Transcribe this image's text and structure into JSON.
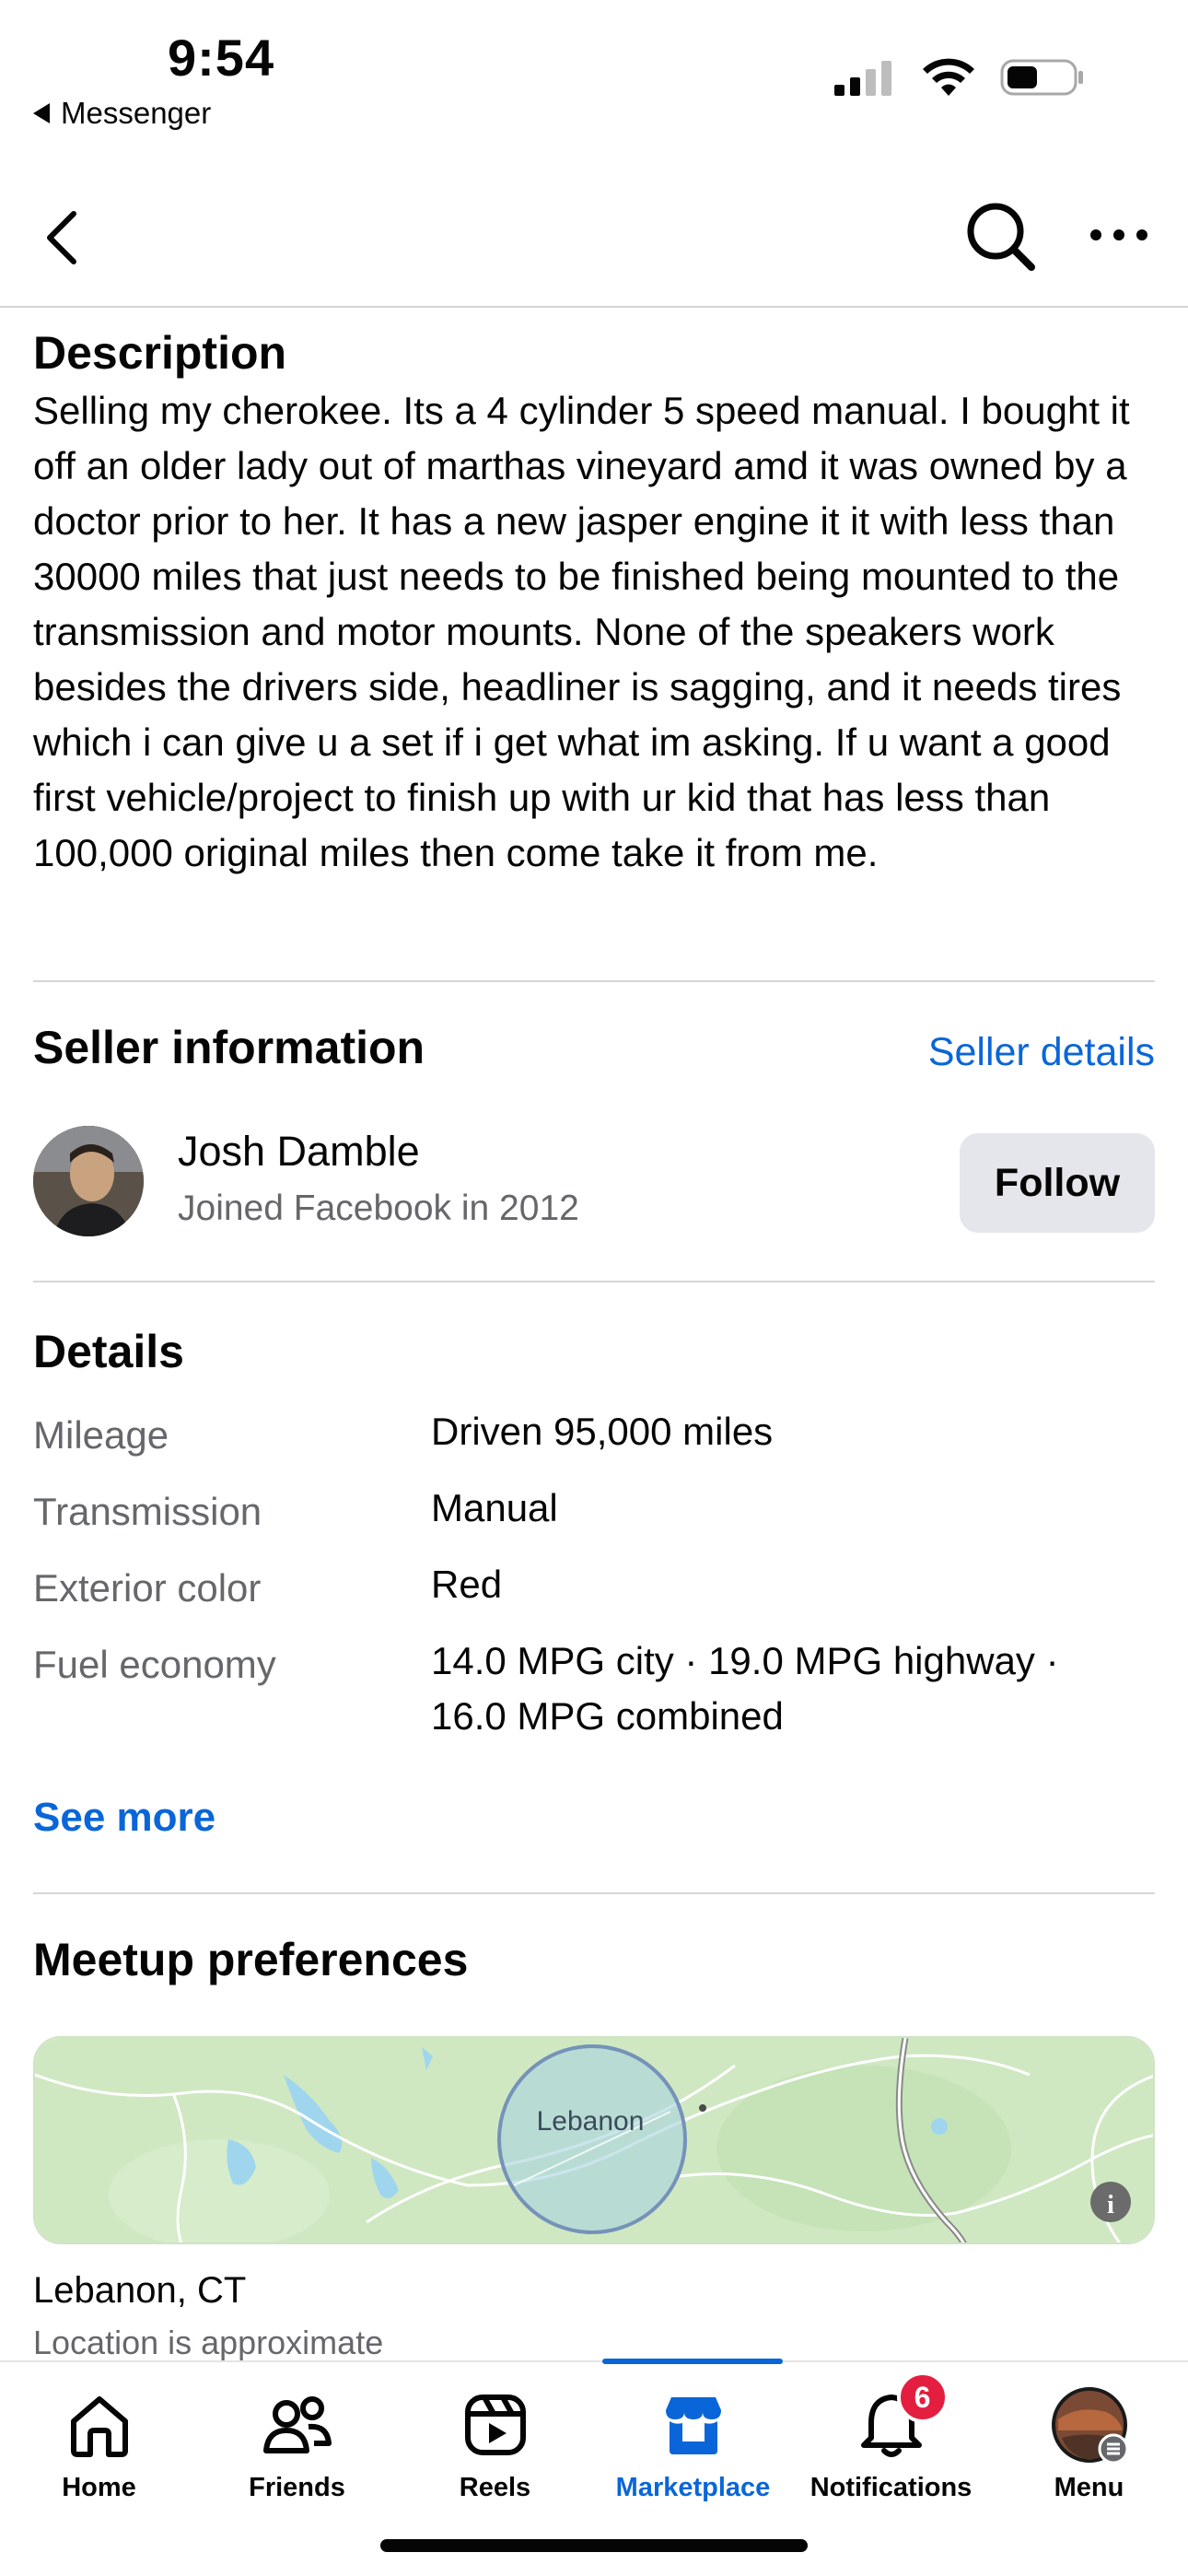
{
  "status_bar": {
    "time": "9:54",
    "back_app": "Messenger",
    "signal_icon": "cellular-signal-icon",
    "wifi_icon": "wifi-icon",
    "battery_icon": "battery-icon"
  },
  "nav": {
    "back_icon": "chevron-left-icon",
    "search_icon": "search-icon",
    "more_icon": "more-horizontal-icon"
  },
  "description": {
    "title": "Description",
    "body": "Selling my cherokee. Its a 4 cylinder 5 speed manual. I bought it off an older lady out of marthas vineyard amd it was owned by a doctor prior to her. It has a new jasper engine it it with less than 30000 miles that just needs to be finished being mounted to the transmission and motor mounts. None of the speakers work besides the drivers side, headliner is sagging, and it needs tires which i can give u a set if i get what im asking. If u want a good first vehicle/project to finish up with ur kid that has less than 100,000 original miles then come take it from me."
  },
  "seller": {
    "title": "Seller information",
    "details_link": "Seller details",
    "name": "Josh Damble",
    "joined": "Joined Facebook in 2012",
    "follow_label": "Follow"
  },
  "details": {
    "title": "Details",
    "rows": [
      {
        "label": "Mileage",
        "value": "Driven 95,000 miles"
      },
      {
        "label": "Transmission",
        "value": "Manual"
      },
      {
        "label": "Exterior color",
        "value": "Red"
      },
      {
        "label": "Fuel economy",
        "value": "14.0 MPG city · 19.0 MPG highway · 16.0 MPG combined"
      }
    ],
    "see_more": "See more"
  },
  "meetup": {
    "title": "Meetup preferences",
    "map_label": "Lebanon",
    "city": "Lebanon, CT",
    "note": "Location is approximate"
  },
  "tabs": [
    {
      "label": "Home",
      "icon": "home-icon"
    },
    {
      "label": "Friends",
      "icon": "friends-icon"
    },
    {
      "label": "Reels",
      "icon": "reels-icon"
    },
    {
      "label": "Marketplace",
      "icon": "marketplace-icon",
      "active": true
    },
    {
      "label": "Notifications",
      "icon": "bell-icon",
      "badge": "6"
    },
    {
      "label": "Menu",
      "icon": "profile-menu-icon"
    }
  ],
  "colors": {
    "accent": "#0a66d8",
    "badge": "#e41e3f",
    "secondary_text": "#65676b",
    "button_bg": "#e4e6eb"
  }
}
